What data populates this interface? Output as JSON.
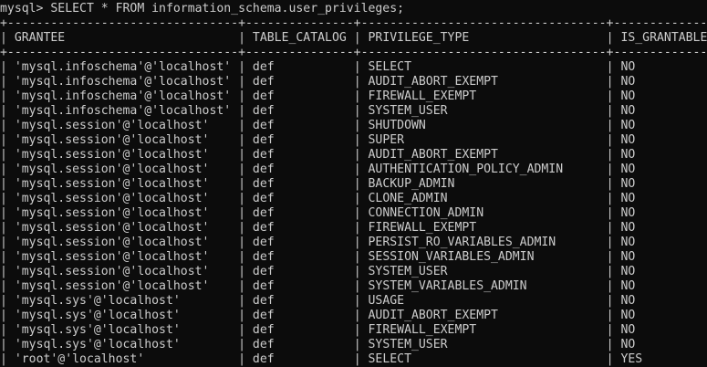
{
  "terminal": {
    "prompt": "mysql> ",
    "command": "SELECT * FROM information_schema.user_privileges;"
  },
  "table": {
    "border_line": "+--------------------------------+---------------+----------------------------------+--------------+",
    "separator": "|",
    "columns": [
      "GRANTEE",
      "TABLE_CATALOG",
      "PRIVILEGE_TYPE",
      "IS_GRANTABLE"
    ],
    "rows": [
      [
        "'mysql.infoschema'@'localhost'",
        "def",
        "SELECT",
        "NO"
      ],
      [
        "'mysql.infoschema'@'localhost'",
        "def",
        "AUDIT_ABORT_EXEMPT",
        "NO"
      ],
      [
        "'mysql.infoschema'@'localhost'",
        "def",
        "FIREWALL_EXEMPT",
        "NO"
      ],
      [
        "'mysql.infoschema'@'localhost'",
        "def",
        "SYSTEM_USER",
        "NO"
      ],
      [
        "'mysql.session'@'localhost'",
        "def",
        "SHUTDOWN",
        "NO"
      ],
      [
        "'mysql.session'@'localhost'",
        "def",
        "SUPER",
        "NO"
      ],
      [
        "'mysql.session'@'localhost'",
        "def",
        "AUDIT_ABORT_EXEMPT",
        "NO"
      ],
      [
        "'mysql.session'@'localhost'",
        "def",
        "AUTHENTICATION_POLICY_ADMIN",
        "NO"
      ],
      [
        "'mysql.session'@'localhost'",
        "def",
        "BACKUP_ADMIN",
        "NO"
      ],
      [
        "'mysql.session'@'localhost'",
        "def",
        "CLONE_ADMIN",
        "NO"
      ],
      [
        "'mysql.session'@'localhost'",
        "def",
        "CONNECTION_ADMIN",
        "NO"
      ],
      [
        "'mysql.session'@'localhost'",
        "def",
        "FIREWALL_EXEMPT",
        "NO"
      ],
      [
        "'mysql.session'@'localhost'",
        "def",
        "PERSIST_RO_VARIABLES_ADMIN",
        "NO"
      ],
      [
        "'mysql.session'@'localhost'",
        "def",
        "SESSION_VARIABLES_ADMIN",
        "NO"
      ],
      [
        "'mysql.session'@'localhost'",
        "def",
        "SYSTEM_USER",
        "NO"
      ],
      [
        "'mysql.session'@'localhost'",
        "def",
        "SYSTEM_VARIABLES_ADMIN",
        "NO"
      ],
      [
        "'mysql.sys'@'localhost'",
        "def",
        "USAGE",
        "NO"
      ],
      [
        "'mysql.sys'@'localhost'",
        "def",
        "AUDIT_ABORT_EXEMPT",
        "NO"
      ],
      [
        "'mysql.sys'@'localhost'",
        "def",
        "FIREWALL_EXEMPT",
        "NO"
      ],
      [
        "'mysql.sys'@'localhost'",
        "def",
        "SYSTEM_USER",
        "NO"
      ],
      [
        "'root'@'localhost'",
        "def",
        "SELECT",
        "YES"
      ]
    ]
  },
  "colors": {
    "background": "#0c0c0c",
    "foreground": "#cccccc"
  }
}
